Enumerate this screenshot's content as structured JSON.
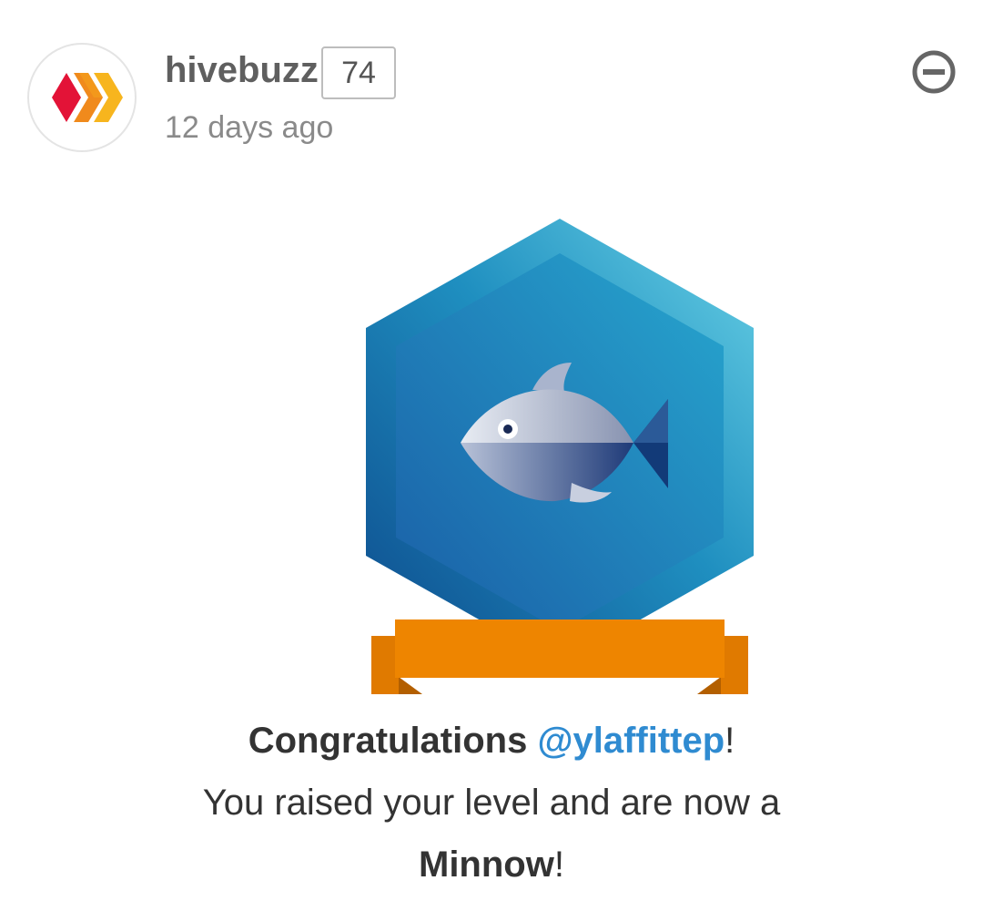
{
  "comment": {
    "author": "hivebuzz",
    "reputation": "74",
    "time_ago": "12 days ago",
    "avatar_icon": "hive-logo-icon",
    "collapse_icon": "collapse-minus-icon"
  },
  "badge": {
    "icon": "minnow-fish-badge-icon",
    "colors": {
      "hex_light": "#5ccbe0",
      "hex_dark": "#0d4a8c",
      "ribbon": "#ee8500"
    }
  },
  "message": {
    "congrats": "Congratulations",
    "mention": "@ylaffittep",
    "exclaim1": "!",
    "line2": "You raised your level and are now a",
    "level": "Minnow",
    "exclaim2": "!"
  }
}
